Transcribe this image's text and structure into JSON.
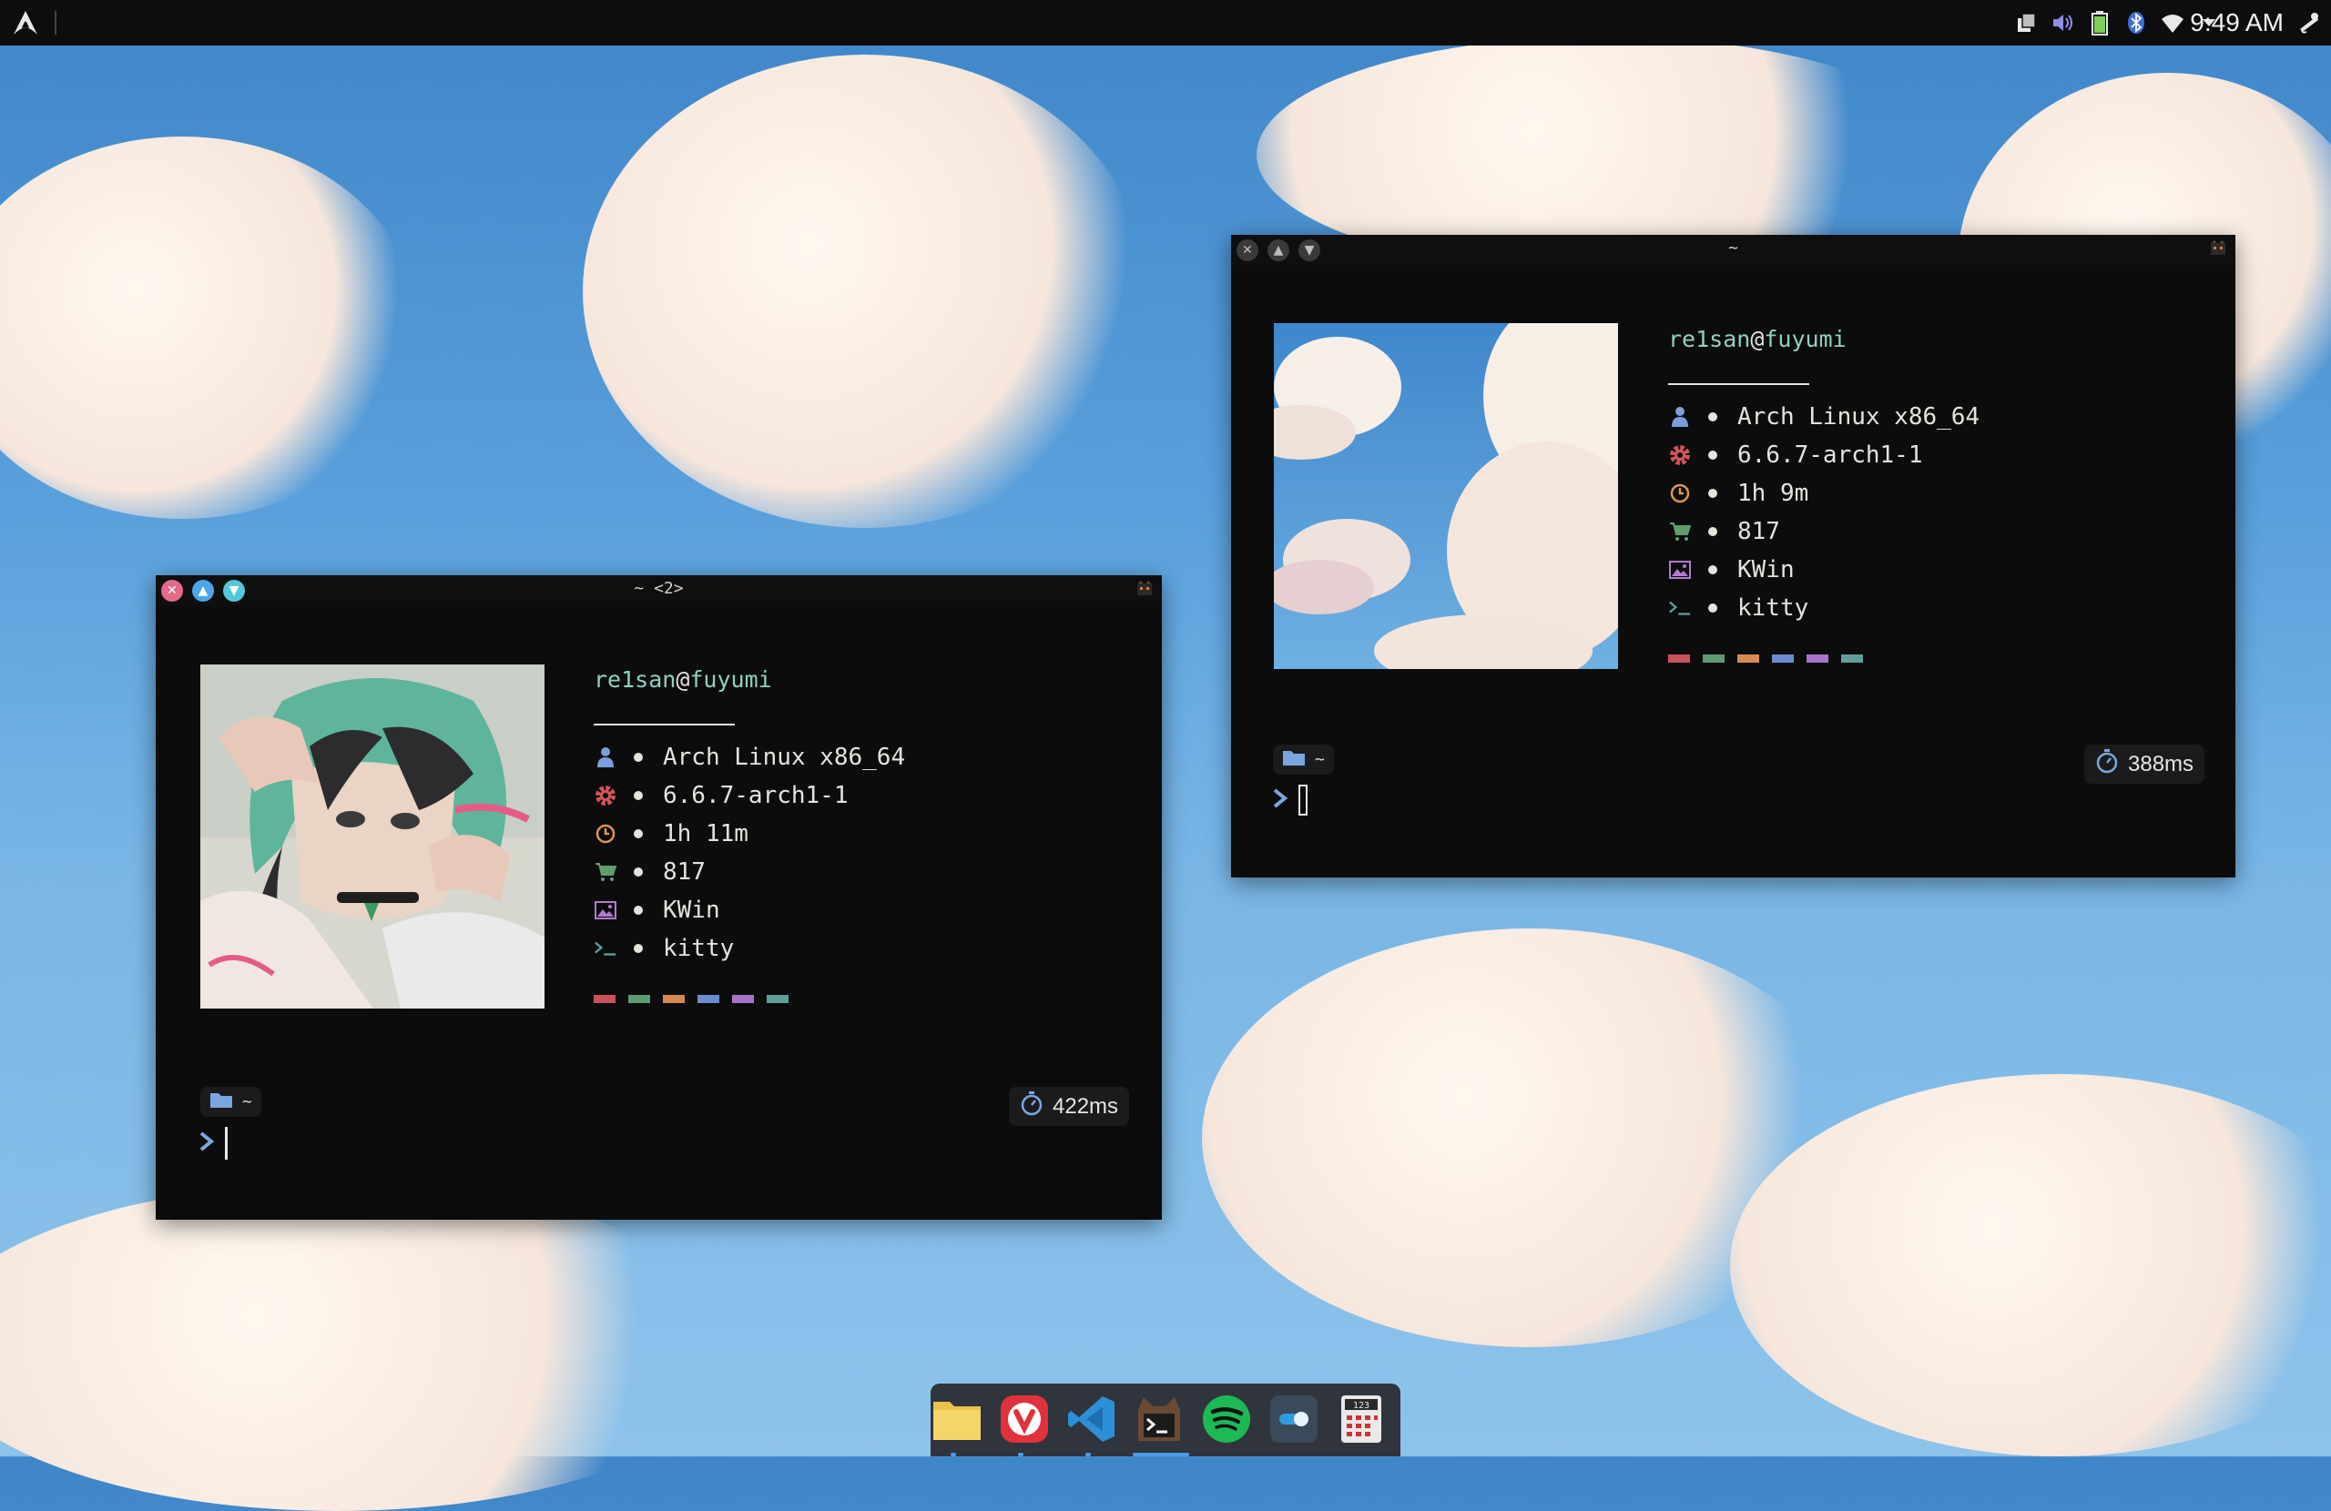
{
  "panel": {
    "clock": "9:49 AM",
    "tray_icons": [
      "clipboard-icon",
      "volume-icon",
      "battery-icon",
      "bluetooth-icon",
      "wifi-icon",
      "tray-expand-icon"
    ]
  },
  "windows": [
    {
      "title": "~ <2>",
      "user": "re1san",
      "at": "@",
      "host": "fuyumi",
      "info": [
        {
          "icon": "user-icon",
          "value": "Arch Linux x86_64"
        },
        {
          "icon": "gear-icon",
          "value": "6.6.7-arch1-1"
        },
        {
          "icon": "clock-icon",
          "value": "1h 11m"
        },
        {
          "icon": "cart-icon",
          "value": "817"
        },
        {
          "icon": "image-icon",
          "value": "KWin"
        },
        {
          "icon": "terminal-icon",
          "value": "kitty"
        }
      ],
      "prompt_dir": "~",
      "timer": "422ms"
    },
    {
      "title": "~",
      "user": "re1san",
      "at": "@",
      "host": "fuyumi",
      "info": [
        {
          "icon": "user-icon",
          "value": "Arch Linux x86_64"
        },
        {
          "icon": "gear-icon",
          "value": "6.6.7-arch1-1"
        },
        {
          "icon": "clock-icon",
          "value": "1h 9m"
        },
        {
          "icon": "cart-icon",
          "value": "817"
        },
        {
          "icon": "image-icon",
          "value": "KWin"
        },
        {
          "icon": "terminal-icon",
          "value": "kitty"
        }
      ],
      "prompt_dir": "~",
      "timer": "388ms"
    }
  ],
  "colors": {
    "palette": [
      "#c8525a",
      "#5d9b73",
      "#d48a52",
      "#6b8ccf",
      "#a973c9",
      "#5f9e9a"
    ],
    "accent_teal": "#8fd1c0",
    "terminal_bg": "#0c0c0d"
  },
  "dock": {
    "apps": [
      "files-icon",
      "vivaldi-icon",
      "vscode-icon",
      "kitty-icon",
      "spotify-icon",
      "settings-icon",
      "calculator-icon"
    ],
    "calculator_label": "123"
  }
}
